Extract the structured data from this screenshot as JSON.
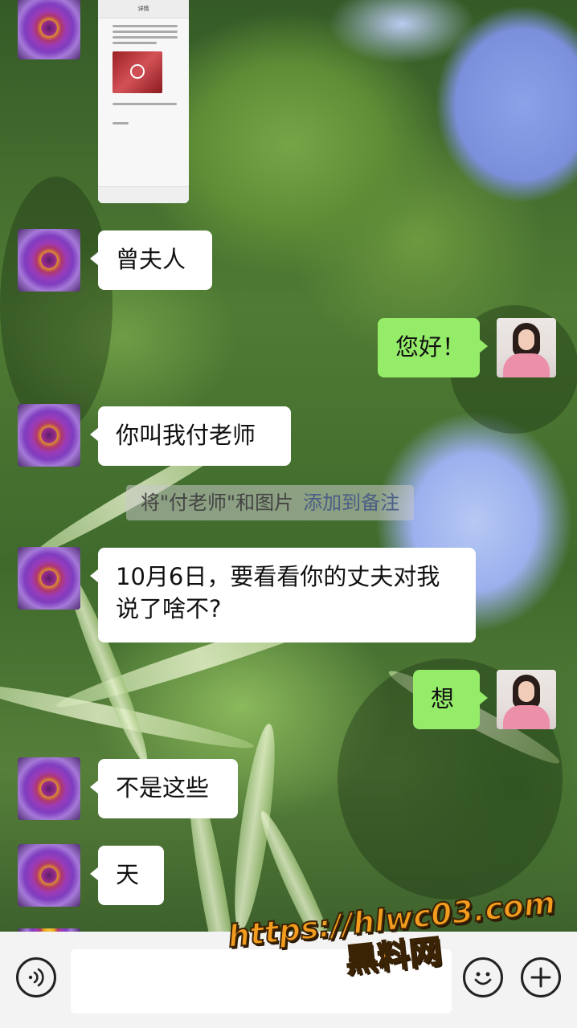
{
  "conversation": {
    "forwarded_screenshot": {
      "header_title": "详情"
    },
    "messages": [
      {
        "side": "left",
        "text": "曾夫人"
      },
      {
        "side": "right",
        "text": "您好！"
      },
      {
        "side": "left",
        "text": "你叫我付老师"
      },
      {
        "side": "left",
        "text": "10月6日，要看看你的丈夫对我",
        "text_line2": "说了啥不?"
      },
      {
        "side": "right",
        "text": "想"
      },
      {
        "side": "left",
        "text": "不是这些"
      },
      {
        "side": "left",
        "text": "天"
      }
    ],
    "system_tip": {
      "text": "将\"付老师\"和图片",
      "link": "添加到备注"
    }
  },
  "input_bar": {
    "icons": [
      "voice-icon",
      "emoji-icon",
      "plus-icon"
    ],
    "input_value": ""
  },
  "watermark": {
    "url": "https://hlwc03.com",
    "name": "黑料网"
  },
  "colors": {
    "bubble_left": "#ffffff",
    "bubble_right": "#95ec69",
    "input_bar_bg": "#f3f3f3",
    "watermark": "#f39c1e"
  }
}
